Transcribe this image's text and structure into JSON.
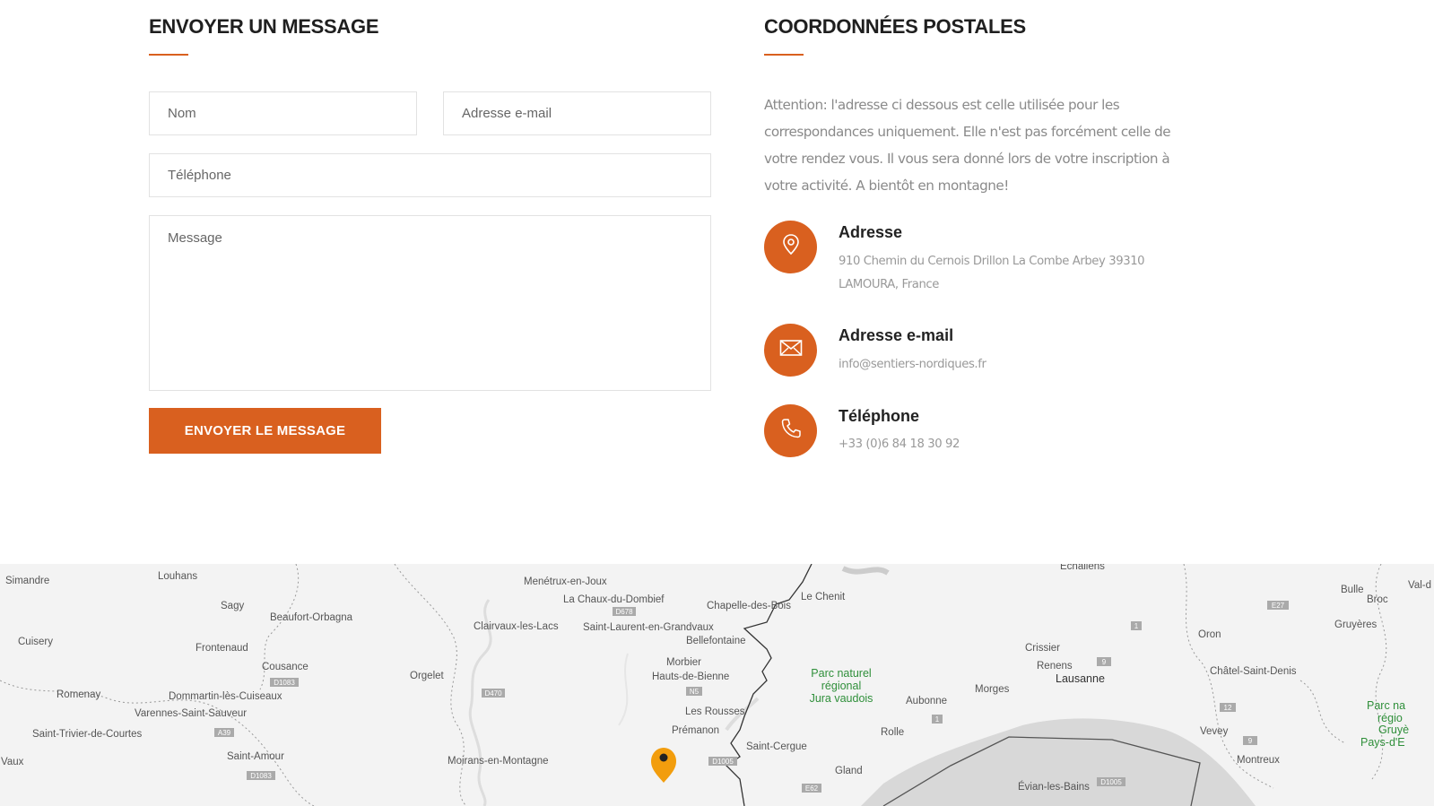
{
  "form": {
    "title": "ENVOYER UN MESSAGE",
    "name_placeholder": "Nom",
    "email_placeholder": "Adresse e-mail",
    "phone_placeholder": "Téléphone",
    "message_placeholder": "Message",
    "submit_label": "ENVOYER LE MESSAGE"
  },
  "contact": {
    "title": "COORDONNÉES POSTALES",
    "intro": "Attention: l'adresse ci dessous est celle utilisée pour les correspondances uniquement. Elle n'est pas forcément celle de votre rendez vous. Il vous sera donné lors de votre inscription à votre activité. A bientôt en montagne!",
    "address": {
      "icon": "map-pin-icon",
      "title": "Adresse",
      "line1": "910 Chemin du Cernois Drillon La Combe Arbey 39310",
      "line2": "LAMOURA, France"
    },
    "email": {
      "icon": "envelope-icon",
      "title": "Adresse e-mail",
      "value": "info@sentiers-nordiques.fr"
    },
    "phone": {
      "icon": "phone-icon",
      "title": "Téléphone",
      "value": "+33 (0)6 84 18 30 92"
    }
  },
  "map": {
    "places": [
      "Simandre",
      "Louhans",
      "Sagy",
      "Beaufort-Orbagna",
      "Cuisery",
      "Frontenaud",
      "Cousance",
      "Romenay",
      "Dommartin-lès-Cuiseaux",
      "Varennes-Saint-Sauveur",
      "Saint-Trivier-de-Courtes",
      "Saint-Amour",
      "Vaux",
      "Menétrux-en-Joux",
      "La Chaux-du-Dombief",
      "Clairvaux-les-Lacs",
      "Saint-Laurent-en-Grandvaux",
      "Chapelle-des-Bois",
      "Bellefontaine",
      "Orgelet",
      "Morbier",
      "Hauts-de-Bienne",
      "Les Rousses",
      "Prémanon",
      "Moirans-en-Montagne",
      "Saint-Cergue",
      "Gland",
      "Le Chenit",
      "Aubonne",
      "Rolle",
      "Morges",
      "Crissier",
      "Renens",
      "Lausanne",
      "Évian-les-Bains",
      "Echallens",
      "Oron",
      "Bulle",
      "Broc",
      "Gruyères",
      "Châtel-Saint-Denis",
      "Vevey",
      "Montreux",
      "Val-d"
    ],
    "park_label": [
      "Parc naturel",
      "régional",
      "Jura vaudois"
    ],
    "park_label_right": [
      "Parc na",
      "régio",
      "Gruyè",
      "Pays-d'E"
    ],
    "road_labels": [
      "D678",
      "N5",
      "D470",
      "D1083",
      "D1083",
      "A39",
      "D1005",
      "E62",
      "D1005",
      "E27",
      "1",
      "9",
      "1",
      "12",
      "9"
    ],
    "marker_icon": "map-marker-icon"
  },
  "colors": {
    "accent": "#d9601f"
  }
}
